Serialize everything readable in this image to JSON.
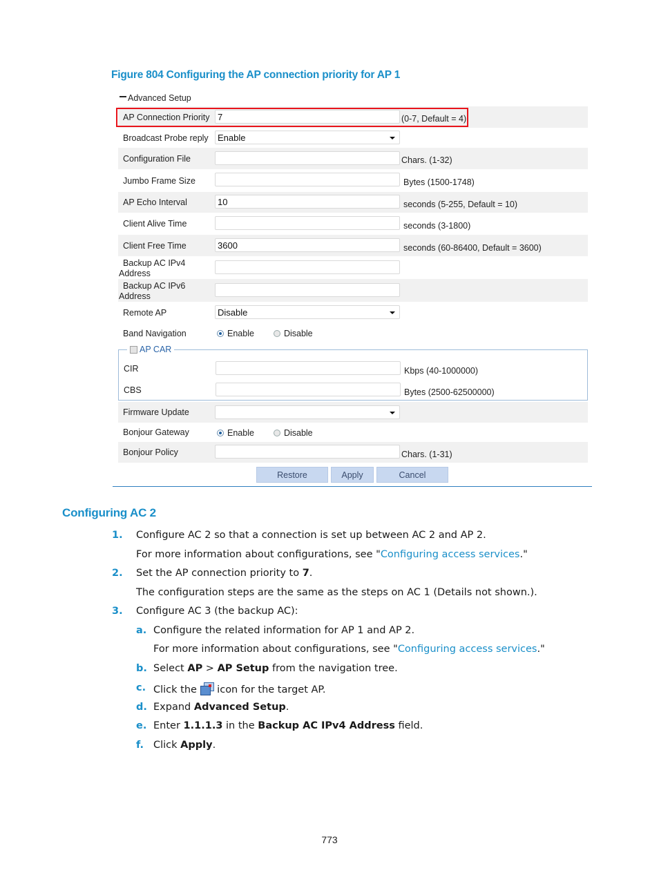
{
  "figure": {
    "caption": "Figure 804 Configuring the AP connection priority for AP 1"
  },
  "form": {
    "section_label": "Advanced Setup",
    "fields": {
      "ap_connection_priority": {
        "label": "AP Connection Priority",
        "value": "7",
        "hint": "(0-7, Default = 4)"
      },
      "broadcast_probe_reply": {
        "label": "Broadcast Probe reply",
        "value": "Enable"
      },
      "configuration_file": {
        "label": "Configuration File",
        "value": "",
        "hint": "Chars. (1-32)"
      },
      "jumbo_frame_size": {
        "label": "Jumbo Frame Size",
        "value": "",
        "hint": "Bytes (1500-1748)"
      },
      "ap_echo_interval": {
        "label": "AP Echo Interval",
        "value": "10",
        "hint": "seconds (5-255, Default = 10)"
      },
      "client_alive_time": {
        "label": "Client Alive Time",
        "value": "",
        "hint": "seconds (3-1800)"
      },
      "client_free_time": {
        "label": "Client Free Time",
        "value": "3600",
        "hint": "seconds (60-86400, Default = 3600)"
      },
      "backup_ac_ipv4": {
        "label_line1": "Backup AC IPv4",
        "label_line2": "Address",
        "value": ""
      },
      "backup_ac_ipv6": {
        "label_line1": "Backup AC IPv6",
        "label_line2": "Address",
        "value": ""
      },
      "remote_ap": {
        "label": "Remote AP",
        "value": "Disable"
      },
      "band_navigation": {
        "label": "Band Navigation",
        "options": [
          "Enable",
          "Disable"
        ],
        "selected": "Enable"
      },
      "ap_car": {
        "label": "AP CAR",
        "checked": false,
        "cir": {
          "label": "CIR",
          "value": "",
          "hint": "Kbps (40-1000000)"
        },
        "cbs": {
          "label": "CBS",
          "value": "",
          "hint": "Bytes (2500-62500000)"
        }
      },
      "firmware_update": {
        "label": "Firmware Update",
        "value": ""
      },
      "bonjour_gateway": {
        "label": "Bonjour Gateway",
        "options": [
          "Enable",
          "Disable"
        ],
        "selected": "Enable"
      },
      "bonjour_policy": {
        "label": "Bonjour Policy",
        "value": "",
        "hint": "Chars. (1-31)"
      }
    },
    "buttons": {
      "restore": "Restore",
      "apply": "Apply",
      "cancel": "Cancel"
    },
    "highlight_color": "#e8141b"
  },
  "section": {
    "title": "Configuring AC 2",
    "steps": [
      {
        "num": "1.",
        "text": "Configure AC 2 so that a connection is set up between AC 2 and AP 2.",
        "note_prefix": "For more information about configurations, see \"",
        "note_link": "Configuring access services",
        "note_suffix": ".\""
      },
      {
        "num": "2.",
        "text_prefix": "Set the AP connection priority to ",
        "text_bold": "7",
        "text_suffix": ".",
        "note": "The configuration steps are the same as the steps on AC 1 (Details not shown.)."
      },
      {
        "num": "3.",
        "text": "Configure AC 3 (the backup AC):",
        "substeps": [
          {
            "num": "a.",
            "text": "Configure the related information for AP 1 and AP 2.",
            "note_prefix": "For more information about configurations, see \"",
            "note_link": "Configuring access services",
            "note_suffix": ".\""
          },
          {
            "num": "b.",
            "t1": "Select ",
            "b1": "AP",
            "t2": " > ",
            "b2": "AP Setup",
            "t3": " from the navigation tree."
          },
          {
            "num": "c.",
            "t1": "Click the ",
            "icon": "ap-setup-icon",
            "t2": " icon for the target AP."
          },
          {
            "num": "d.",
            "t1": "Expand ",
            "b1": "Advanced Setup",
            "t2": "."
          },
          {
            "num": "e.",
            "t1": "Enter ",
            "b1": "1.1.1.3",
            "t2": " in the ",
            "b2": "Backup AC IPv4 Address",
            "t3": " field."
          },
          {
            "num": "f.",
            "t1": "Click ",
            "b1": "Apply",
            "t2": "."
          }
        ]
      }
    ],
    "accent_color": "#1a8fc9"
  },
  "page_number": "773"
}
